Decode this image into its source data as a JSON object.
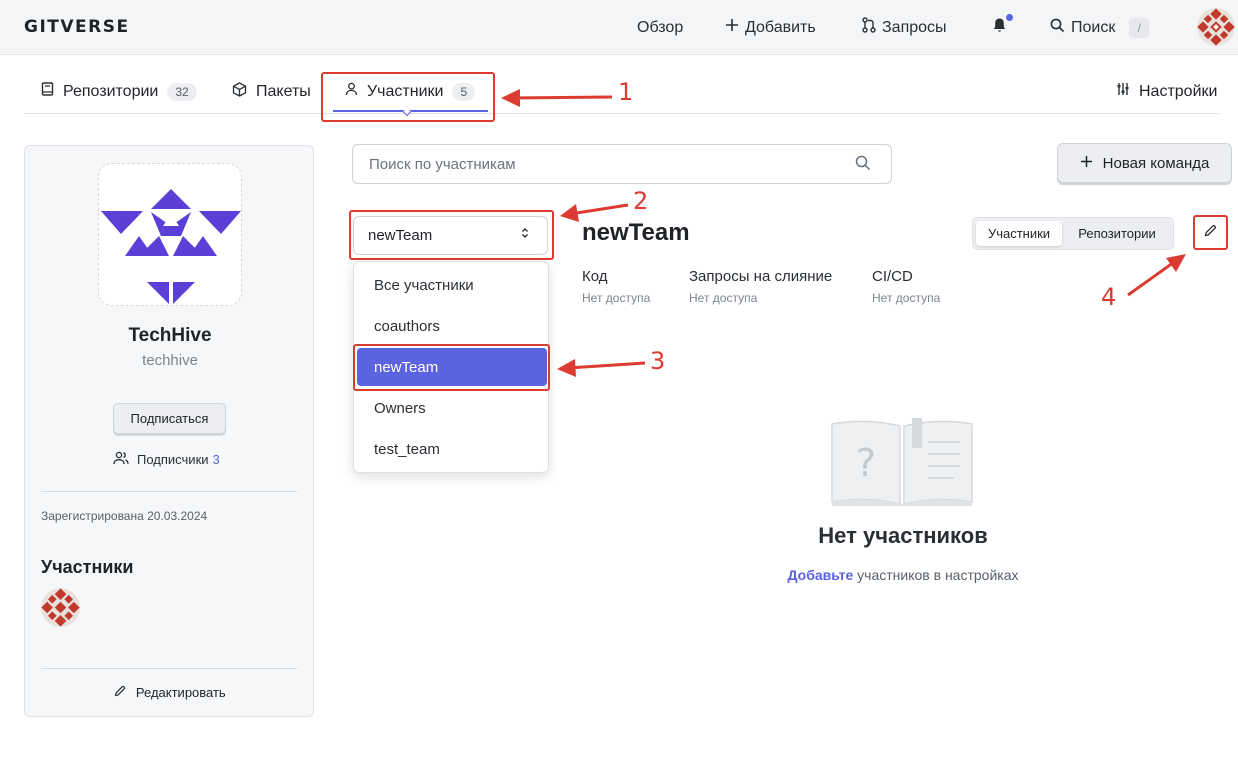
{
  "header": {
    "logo": "GITVERSE",
    "nav": {
      "overview": "Обзор",
      "add": "Добавить",
      "requests": "Запросы",
      "search": "Поиск",
      "search_shortcut": "/"
    },
    "icons": [
      "plus-icon",
      "pull-request-icon",
      "bell-icon",
      "search-icon"
    ],
    "accent": "#5b63e0"
  },
  "tabs": [
    {
      "label": "Репозитории",
      "count": "32"
    },
    {
      "label": "Пакеты"
    },
    {
      "label": "Участники",
      "count": "5",
      "active": true
    },
    {
      "label": "Настройки"
    }
  ],
  "profile": {
    "name": "TechHive",
    "handle": "techhive",
    "subscribe": "Подписаться",
    "subscribers_label": "Подписчики",
    "subscribers_count": "3",
    "registered": "Зарегистрирована 20.03.2024",
    "members_title": "Участники",
    "edit": "Редактировать"
  },
  "main": {
    "search_placeholder": "Поиск по участникам",
    "new_team": "Новая команда",
    "team_select_value": "newTeam",
    "dropdown": [
      "Все участники",
      "coauthors",
      "newTeam",
      "Owners",
      "test_team"
    ],
    "selected_index": 2,
    "team_title": "newTeam",
    "permissions": [
      {
        "label": "Код",
        "value": "Нет доступа"
      },
      {
        "label": "Запросы на слияние",
        "value": "Нет доступа"
      },
      {
        "label": "CI/CD",
        "value": "Нет доступа"
      }
    ],
    "segments": [
      "Участники",
      "Репозитории"
    ],
    "empty_title": "Нет участников",
    "empty_link": "Добавьте",
    "empty_rest": "участников в настройках"
  },
  "annotations": [
    "1",
    "2",
    "3",
    "4"
  ],
  "annotation_color": "#dc3b31"
}
